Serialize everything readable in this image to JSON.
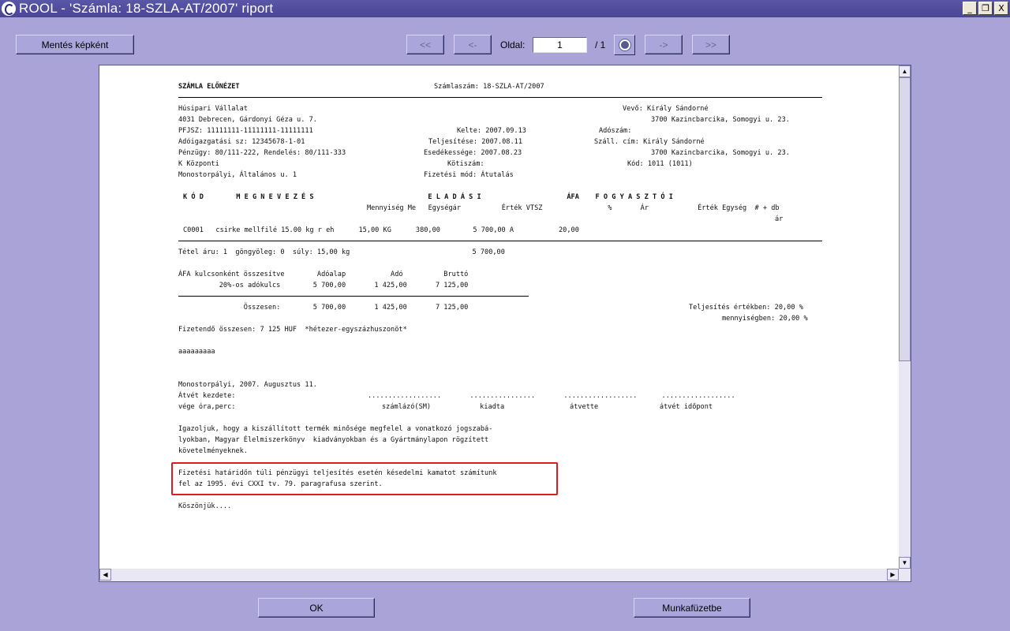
{
  "window": {
    "title": "ROOL  -  'Számla: 18-SZLA-AT/2007' riport",
    "min": "_",
    "restore": "❐",
    "close": "X"
  },
  "toolbar": {
    "save_image": "Mentés képként",
    "first": "<<",
    "prev": "<-",
    "next": "->",
    "last": ">>",
    "page_label": "Oldal:",
    "page_value": "1",
    "page_total": "/ 1"
  },
  "footer": {
    "ok": "OK",
    "workbook": "Munkafüzetbe"
  },
  "report": {
    "h_left": "SZÁMLA ELŐNÉZET",
    "h_right": "Számlaszám: 18-SZLA-AT/2007",
    "rows": [
      "Húsipari Vállalat",
      "4031 Debrecen, Gárdonyi Géza u. 7.",
      "PFJSZ: 11111111-11111111-11111111",
      "Adóigazgatási sz: 12345678-1-01",
      "Pénzügy: 80/111-222, Rendelés: 80/111-333",
      "K Központi",
      "Monostorpályi, Általános u. 1"
    ],
    "mid": [
      "Kelte: 2007.09.13",
      "Teljesítése: 2007.08.11",
      "Esedékessége: 2007.08.23",
      "Kötiszám:",
      "Fizetési mód: Átutalás"
    ],
    "buyer": [
      "Vevő: Király Sándorné",
      "3700 Kazincbarcika, Somogyi u. 23.",
      "Adószám:",
      "Száll. cím: Király Sándorné",
      "3700 Kazincbarcika, Somogyi u. 23.",
      "Kód: 1011 (1011)"
    ],
    "th1": "K Ó D        M E G N E V E Z É S                            E L A D Á S I                     ÁFA    F O G Y A S Z T Ó I",
    "th2": "Mennyiség Me   Egységár          Érték VTSZ                %       Ár            Érték Egység  # + db",
    "th3": "ár",
    "item": "C0001   csirke mellfilé 15.00 kg r eh      15,00 KG      380,00        5 700,00 A           20,00",
    "summary": "Tétel áru: 1  göngyöleg: 0  súly: 15,00 kg                              5 700,00",
    "vat_head": "ÁFA kulcsonként összesítve        Adóalap           Adó          Bruttó",
    "vat_row": "          20%-os adókulcs        5 700,00       1 425,00       7 125,00",
    "total": "                Összesen:        5 700,00       1 425,00       7 125,00",
    "perf1": "Teljesítés értékben: 20,00 %",
    "perf2": "mennyiségben: 20,00 %",
    "payable": "Fizetendő összesen: 7 125 HUF  *hétezer-egyszázhuszonöt*",
    "aaa": "aaaaaaaaa",
    "place": "Monostorpályi, 2007. Augusztus 11.",
    "atvet": "Átvét kezdete:",
    "vege": "vége óra,perc:",
    "dots": "..................       ................       ..................      ..................",
    "sigs": "számlázó(SM)            kiadta                átvette               átvét időpont",
    "cert1": "Igazoljuk, hogy a kiszállított termék minősége megfelel a vonatkozó jogszabá-",
    "cert2": "lyokban, Magyar Élelmiszerkönyv  kiadványokban és a Gyártmánylapon rögzített",
    "cert3": "követelményeknek.",
    "late1": "Fizetési határidőn túli pénzügyi teljesítés esetén késedelmi kamatot számítunk",
    "late2": "fel az 1995. évi CXXI tv. 79. paragrafusa szerint.",
    "thanks": "Köszönjük...."
  }
}
